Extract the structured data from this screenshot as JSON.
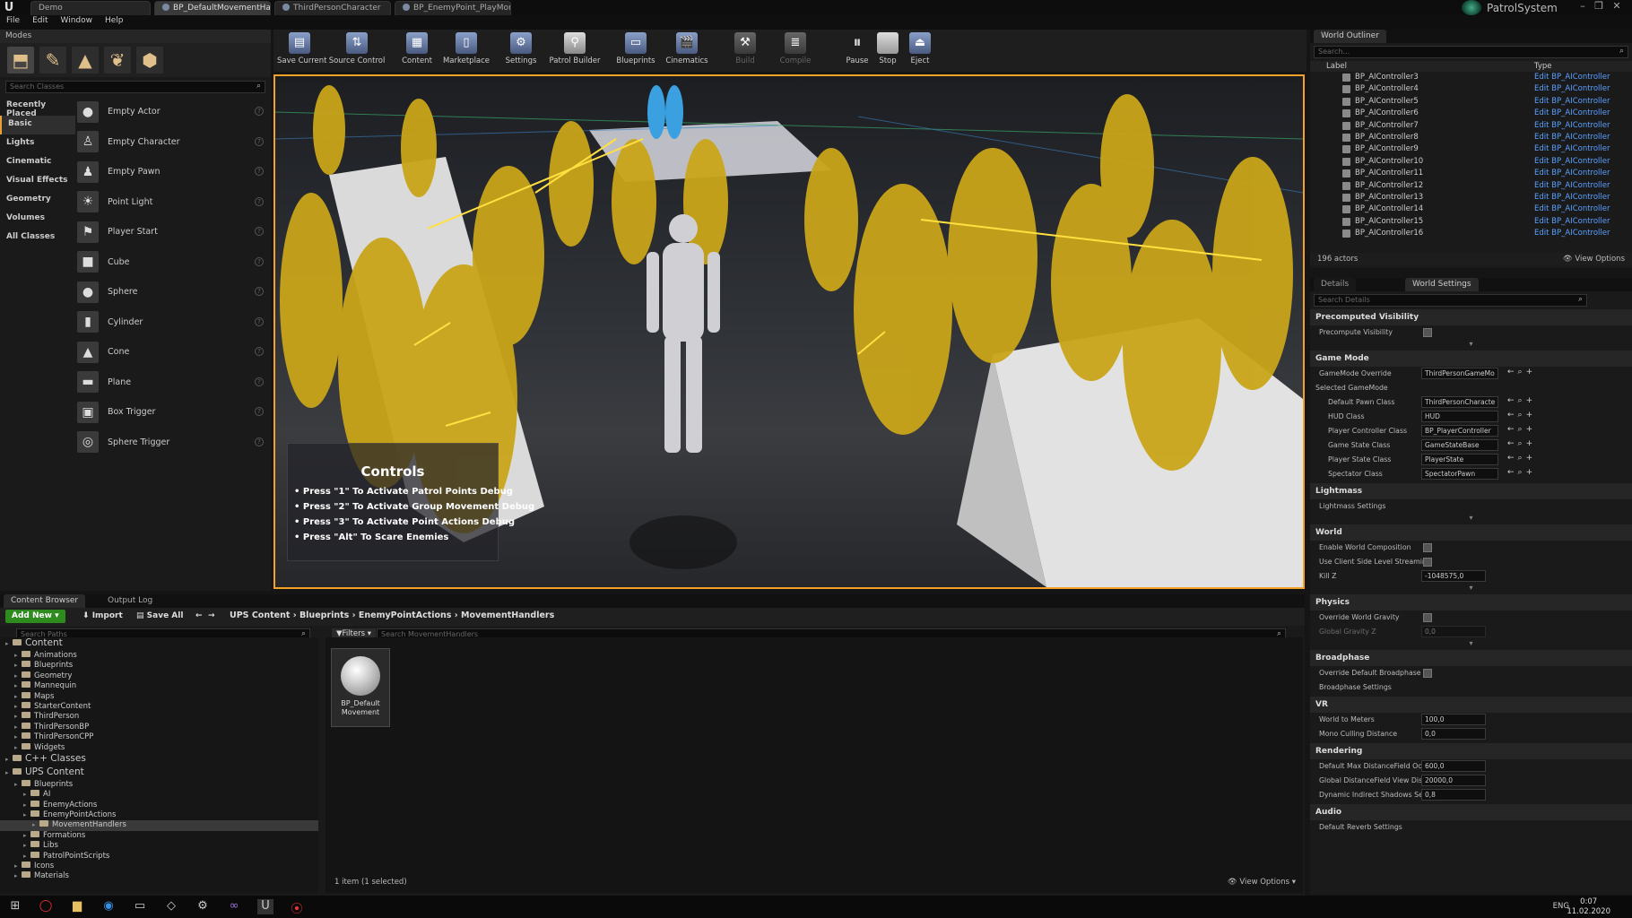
{
  "window": {
    "app_tab": "Demo",
    "doc_tabs": [
      "BP_DefaultMovementHan",
      "ThirdPersonCharacter",
      "BP_EnemyPoint_PlayMon"
    ],
    "project_name": "PatrolSystem"
  },
  "menu": [
    "File",
    "Edit",
    "Window",
    "Help"
  ],
  "modes": {
    "title": "Modes",
    "search_placeholder": "Search Classes",
    "categories": [
      "Recently Placed",
      "Basic",
      "Lights",
      "Cinematic",
      "Visual Effects",
      "Geometry",
      "Volumes",
      "All Classes"
    ],
    "selected_category": "Basic",
    "items": [
      "Empty Actor",
      "Empty Character",
      "Empty Pawn",
      "Point Light",
      "Player Start",
      "Cube",
      "Sphere",
      "Cylinder",
      "Cone",
      "Plane",
      "Box Trigger",
      "Sphere Trigger"
    ]
  },
  "toolbar": {
    "items": [
      "Save Current",
      "Source Control",
      "Content",
      "Marketplace",
      "Settings",
      "Patrol Builder",
      "Blueprints",
      "Cinematics",
      "Build",
      "Compile",
      "Pause",
      "Stop",
      "Eject"
    ]
  },
  "viewport": {
    "controls_title": "Controls",
    "controls_lines": [
      "• Press \"1\" To Activate Patrol Points Debug",
      "• Press \"2\" To Activate Group Movement Debug",
      "• Press \"3\" To Activate Point Actions Debug",
      "• Press \"Alt\" To Scare Enemies"
    ]
  },
  "outliner": {
    "title": "World Outliner",
    "search_placeholder": "Search...",
    "col_label": "Label",
    "col_type": "Type",
    "rows": [
      {
        "label": "BP_AIController3",
        "type": "Edit BP_AIController"
      },
      {
        "label": "BP_AIController4",
        "type": "Edit BP_AIController"
      },
      {
        "label": "BP_AIController5",
        "type": "Edit BP_AIController"
      },
      {
        "label": "BP_AIController6",
        "type": "Edit BP_AIController"
      },
      {
        "label": "BP_AIController7",
        "type": "Edit BP_AIController"
      },
      {
        "label": "BP_AIController8",
        "type": "Edit BP_AIController"
      },
      {
        "label": "BP_AIController9",
        "type": "Edit BP_AIController"
      },
      {
        "label": "BP_AIController10",
        "type": "Edit BP_AIController"
      },
      {
        "label": "BP_AIController11",
        "type": "Edit BP_AIController"
      },
      {
        "label": "BP_AIController12",
        "type": "Edit BP_AIController"
      },
      {
        "label": "BP_AIController13",
        "type": "Edit BP_AIController"
      },
      {
        "label": "BP_AIController14",
        "type": "Edit BP_AIController"
      },
      {
        "label": "BP_AIController15",
        "type": "Edit BP_AIController"
      },
      {
        "label": "BP_AIController16",
        "type": "Edit BP_AIController"
      }
    ],
    "actor_count": "196 actors",
    "view_options": "View Options"
  },
  "details": {
    "tab_details": "Details",
    "tab_world_settings": "World Settings",
    "search_placeholder": "Search Details",
    "sections": {
      "precomputed": "Precomputed Visibility",
      "game_mode": "Game Mode",
      "lightmass": "Lightmass",
      "world": "World",
      "physics": "Physics",
      "broadphase": "Broadphase",
      "vr": "VR",
      "rendering": "Rendering",
      "audio": "Audio"
    },
    "precompute_visibility": "Precompute Visibility",
    "gamemode_override": {
      "label": "GameMode Override",
      "value": "ThirdPersonGameMo"
    },
    "selected_gamemode": "Selected GameMode",
    "default_pawn": {
      "label": "Default Pawn Class",
      "value": "ThirdPersonCharacte"
    },
    "hud": {
      "label": "HUD Class",
      "value": "HUD"
    },
    "player_controller": {
      "label": "Player Controller Class",
      "value": "BP_PlayerController"
    },
    "game_state": {
      "label": "Game State Class",
      "value": "GameStateBase"
    },
    "player_state": {
      "label": "Player State Class",
      "value": "PlayerState"
    },
    "spectator": {
      "label": "Spectator Class",
      "value": "SpectatorPawn"
    },
    "lightmass_settings": "Lightmass Settings",
    "enable_world_comp": "Enable World Composition",
    "use_client_side": "Use Client Side Level Streamin",
    "kill_z": {
      "label": "Kill Z",
      "value": "-1048575,0"
    },
    "override_gravity": "Override World Gravity",
    "global_gravity": {
      "label": "Global Gravity Z",
      "value": "0,0"
    },
    "override_broadphase": "Override Default Broadphase S",
    "broadphase_settings": "Broadphase Settings",
    "world_to_meters": {
      "label": "World to Meters",
      "value": "100,0"
    },
    "mono_culling": {
      "label": "Mono Culling Distance",
      "value": "0,0"
    },
    "max_distance_field": {
      "label": "Default Max DistanceField Occ",
      "value": "600,0"
    },
    "global_df_view": {
      "label": "Global DistanceField View Dist",
      "value": "20000,0"
    },
    "dyn_indirect": {
      "label": "Dynamic Indirect Shadows Sel",
      "value": "0,8"
    },
    "default_reverb": "Default Reverb Settings"
  },
  "content_browser": {
    "tab_cb": "Content Browser",
    "tab_log": "Output Log",
    "add_new": "Add New",
    "import": "Import",
    "save_all": "Save All",
    "breadcrumb": [
      "UPS Content",
      "Blueprints",
      "EnemyPointActions",
      "MovementHandlers"
    ],
    "search_paths": "Search Paths",
    "filters": "Filters",
    "search_assets": "Search MovementHandlers",
    "tree": [
      {
        "name": "Content",
        "level": 0,
        "big": true
      },
      {
        "name": "Animations",
        "level": 1
      },
      {
        "name": "Blueprints",
        "level": 1
      },
      {
        "name": "Geometry",
        "level": 1
      },
      {
        "name": "Mannequin",
        "level": 1
      },
      {
        "name": "Maps",
        "level": 1
      },
      {
        "name": "StarterContent",
        "level": 1
      },
      {
        "name": "ThirdPerson",
        "level": 1
      },
      {
        "name": "ThirdPersonBP",
        "level": 1
      },
      {
        "name": "ThirdPersonCPP",
        "level": 1
      },
      {
        "name": "Widgets",
        "level": 1
      },
      {
        "name": "C++ Classes",
        "level": 0,
        "big": true
      },
      {
        "name": "UPS Content",
        "level": 0,
        "big": true
      },
      {
        "name": "Blueprints",
        "level": 1
      },
      {
        "name": "AI",
        "level": 2
      },
      {
        "name": "EnemyActions",
        "level": 2
      },
      {
        "name": "EnemyPointActions",
        "level": 2
      },
      {
        "name": "MovementHandlers",
        "level": 3,
        "sel": true
      },
      {
        "name": "Formations",
        "level": 2
      },
      {
        "name": "Libs",
        "level": 2
      },
      {
        "name": "PatrolPointScripts",
        "level": 2
      },
      {
        "name": "Icons",
        "level": 1
      },
      {
        "name": "Materials",
        "level": 1
      }
    ],
    "asset_name": "BP_Default Movement",
    "item_count": "1 item (1 selected)",
    "view_options": "View Options"
  },
  "taskbar": {
    "lang": "ENG",
    "time": "0:07",
    "date": "11.02.2020"
  }
}
